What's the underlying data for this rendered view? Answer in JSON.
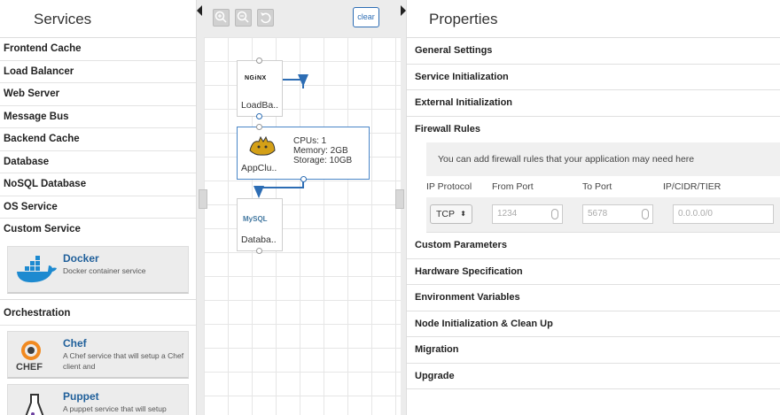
{
  "services_panel": {
    "title": "Services",
    "items": [
      "Frontend Cache",
      "Load Balancer",
      "Web Server",
      "Message Bus",
      "Backend Cache",
      "Database",
      "NoSQL Database",
      "OS Service",
      "Custom Service"
    ],
    "custom_cards": [
      {
        "name": "Docker",
        "desc": "Docker container service",
        "icon": "docker-icon"
      }
    ],
    "orchestration_label": "Orchestration",
    "orchestration_cards": [
      {
        "name": "Chef",
        "desc": "A Chef service that will setup a Chef client and",
        "icon": "chef-icon",
        "icon_text": "CHEF"
      },
      {
        "name": "Puppet",
        "desc": "A puppet service that will setup Puppet agent and",
        "icon": "puppet-icon"
      }
    ]
  },
  "canvas": {
    "toolbar": {
      "zoom_in_icon": "zoom-in-icon",
      "zoom_out_icon": "zoom-out-icon",
      "reset_icon": "undo-icon",
      "clear_label": "clear"
    },
    "nodes": [
      {
        "label": "LoadBa..",
        "logo_text": "NGiNX",
        "icon": "nginx-logo"
      },
      {
        "label": "AppClu..",
        "icon": "tomcat-logo",
        "details": [
          "CPUs: 1",
          "Memory: 2GB",
          "Storage: 10GB"
        ]
      },
      {
        "label": "Databa..",
        "logo_text": "MySQL",
        "icon": "mysql-logo"
      }
    ],
    "accent_color": "#2d6db4"
  },
  "properties_panel": {
    "title": "Properties",
    "sections_top": [
      "General Settings",
      "Service Initialization",
      "External Initialization",
      "Firewall Rules"
    ],
    "firewall": {
      "info": "You can add firewall rules that your application may need here",
      "headers": [
        "IP Protocol",
        "From Port",
        "To Port",
        "IP/CIDR/TIER"
      ],
      "row": {
        "protocol": "TCP",
        "from_port": "1234",
        "to_port": "5678",
        "cidr": "0.0.0.0/0"
      }
    },
    "sections_bottom": [
      "Custom Parameters",
      "Hardware Specification",
      "Environment Variables",
      "Node Initialization & Clean Up",
      "Migration",
      "Upgrade"
    ]
  }
}
